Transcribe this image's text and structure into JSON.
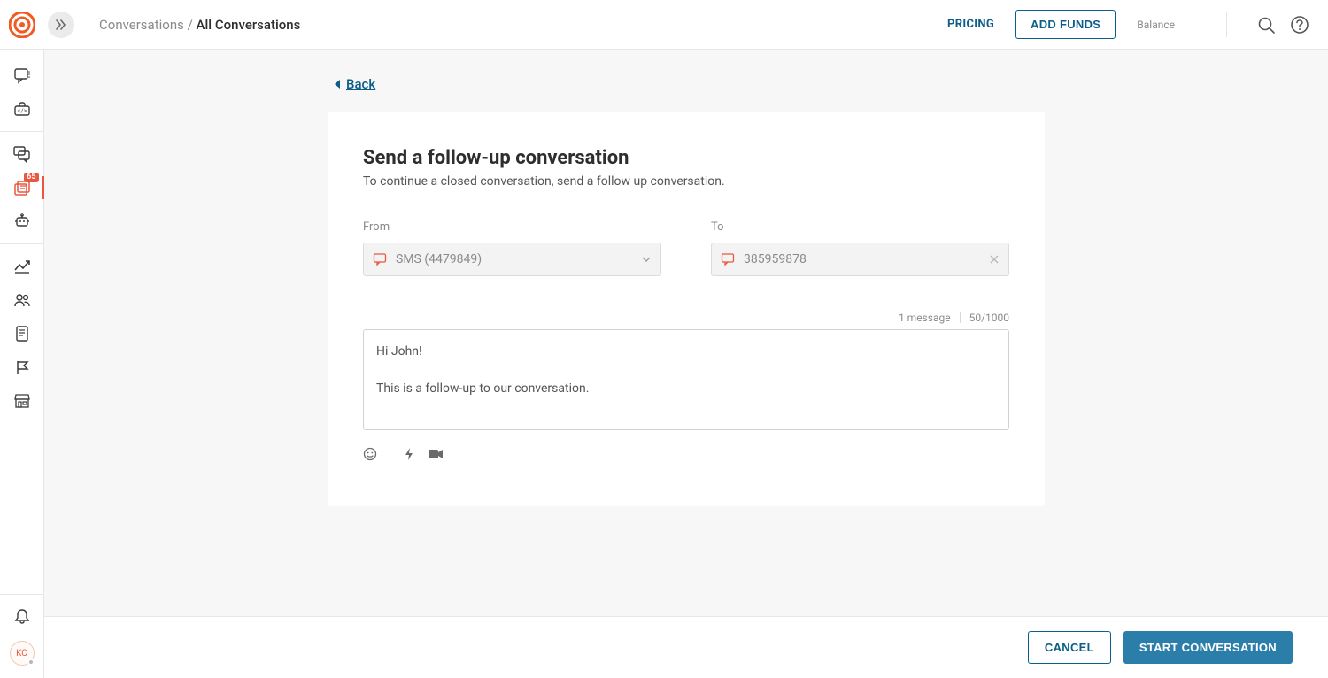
{
  "header": {
    "breadcrumb_parent": "Conversations",
    "breadcrumb_sep": " / ",
    "breadcrumb_current": "All Conversations",
    "pricing_label": "PRICING",
    "add_funds_label": "ADD FUNDS",
    "balance_label": "Balance"
  },
  "sidebar": {
    "badge": "65",
    "avatar_initials": "KC"
  },
  "main": {
    "back_label": "Back",
    "card_title": "Send a follow-up conversation",
    "card_subtitle": "To continue a closed conversation, send a follow up conversation.",
    "from_label": "From",
    "from_value": "SMS (4479849)",
    "to_label": "To",
    "to_value": "385959878",
    "message_count_label": "1 message",
    "char_counter": "50/1000",
    "message_body": "Hi John!\n\nThis is a follow-up to our conversation."
  },
  "footer": {
    "cancel_label": "CANCEL",
    "start_label": "START CONVERSATION"
  }
}
